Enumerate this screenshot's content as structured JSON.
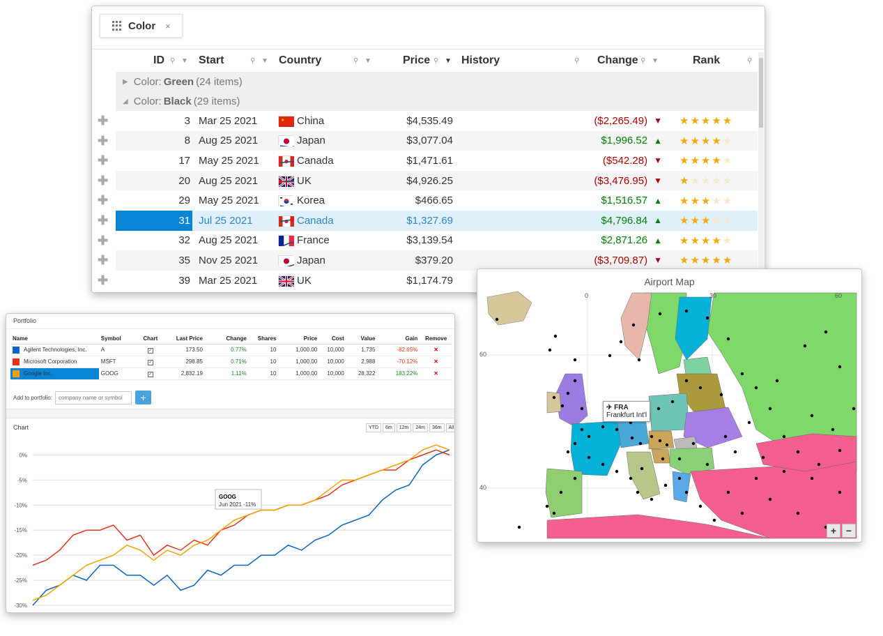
{
  "grid": {
    "group_chip": {
      "label": "Color",
      "close": "×"
    },
    "columns": [
      "ID",
      "Start",
      "Country",
      "Price",
      "History",
      "Change",
      "Rank"
    ],
    "groups": [
      {
        "prefix": "Color:",
        "name": "Green",
        "count": "(24 items)",
        "expanded": false
      },
      {
        "prefix": "Color:",
        "name": "Black",
        "count": "(29 items)",
        "expanded": true
      }
    ],
    "rows": [
      {
        "id": "3",
        "start": "Mar 25 2021",
        "country": "China",
        "flag": "cn",
        "price": "$4,535.49",
        "change": "($2,265.49)",
        "dir": "down",
        "rank": 5
      },
      {
        "id": "8",
        "start": "Aug 25 2021",
        "country": "Japan",
        "flag": "jp",
        "price": "$3,077.04",
        "change": "$1,996.52",
        "dir": "up",
        "rank": 4
      },
      {
        "id": "17",
        "start": "May 25 2021",
        "country": "Canada",
        "flag": "ca",
        "price": "$1,471.61",
        "change": "($542.28)",
        "dir": "down",
        "rank": 4
      },
      {
        "id": "20",
        "start": "Aug 25 2021",
        "country": "UK",
        "flag": "uk",
        "price": "$4,926.25",
        "change": "($3,476.95)",
        "dir": "down",
        "rank": 1
      },
      {
        "id": "29",
        "start": "May 25 2021",
        "country": "Korea",
        "flag": "kr",
        "price": "$466.65",
        "change": "$1,516.57",
        "dir": "up",
        "rank": 3
      },
      {
        "id": "31",
        "start": "Jul 25 2021",
        "country": "Canada",
        "flag": "ca",
        "price": "$1,327.69",
        "change": "$4,796.84",
        "dir": "up",
        "rank": 3,
        "selected": true
      },
      {
        "id": "32",
        "start": "Aug 25 2021",
        "country": "France",
        "flag": "fr",
        "price": "$3,139.54",
        "change": "$2,871.26",
        "dir": "up",
        "rank": 4
      },
      {
        "id": "35",
        "start": "Nov 25 2021",
        "country": "Japan",
        "flag": "jp",
        "price": "$379.20",
        "change": "($3,709.87)",
        "dir": "down",
        "rank": 5
      },
      {
        "id": "39",
        "start": "Mar 25 2021",
        "country": "UK",
        "flag": "uk",
        "price": "$1,174.79",
        "change": "",
        "dir": "",
        "rank": 0
      }
    ],
    "colors": {
      "selected": "#0a84d4",
      "negative": "#b00000",
      "positive": "#008000",
      "star": "#f4a80b",
      "sparkline": "#1f4e8c",
      "spark_marker": "#e8141a"
    }
  },
  "portfolio": {
    "title": "Portfolio",
    "columns": [
      "Name",
      "Symbol",
      "Chart",
      "Last Price",
      "Change",
      "Shares",
      "Price",
      "Cost",
      "Value",
      "Gain",
      "Remove"
    ],
    "rows": [
      {
        "name": "Agilent Technologies, Inc.",
        "color": "#0a64c8",
        "symbol": "A",
        "last": "173.50",
        "change": "0.77%",
        "shares": "10",
        "price": "1,000.00",
        "cost": "10,000",
        "value": "1,735",
        "gain": "-82.65%",
        "gain_dir": "neg"
      },
      {
        "name": "Microsoft Corporation",
        "color": "#e8331c",
        "symbol": "MSFT",
        "last": "298.85",
        "change": "0.71%",
        "shares": "10",
        "price": "1,000.00",
        "cost": "10,000",
        "value": "2,988",
        "gain": "-70.12%",
        "gain_dir": "neg"
      },
      {
        "name": "Google Inc.",
        "color": "#f5a200",
        "symbol": "GOOG",
        "last": "2,832.19",
        "change": "1.11%",
        "shares": "10",
        "price": "1,000.00",
        "cost": "10,000",
        "value": "28,322",
        "gain": "183.22%",
        "gain_dir": "pos",
        "selected": true
      }
    ],
    "add_label": "Add to portfolio:",
    "add_placeholder": "company name or symbol",
    "add_button": "+",
    "remove_glyph": "✕",
    "check_glyph": "✓",
    "chart_title": "Chart",
    "ranges": [
      "YTD",
      "6m",
      "12m",
      "24m",
      "36m",
      "All"
    ],
    "tooltip": {
      "title": "GOOG",
      "text": "Jun 2021 -11%"
    }
  },
  "map": {
    "title": "Airport Map",
    "x_ticks": [
      "0",
      "30",
      "60"
    ],
    "y_ticks": [
      "60",
      "40"
    ],
    "tooltip": {
      "code": "FRA",
      "name": "Frankfurt Int'l"
    },
    "zoom_in": "+",
    "zoom_out": "−"
  },
  "chart_data": {
    "type": "line",
    "title": "",
    "xlabel": "",
    "ylabel": "",
    "ylim": [
      -30,
      2
    ],
    "yticks": [
      "0%",
      "-5%",
      "-10%",
      "-15%",
      "-20%",
      "-25%",
      "-30%"
    ],
    "series": [
      {
        "name": "A",
        "color": "#0a64c8",
        "values": [
          -30,
          -27,
          -26,
          -24,
          -25,
          -22,
          -22,
          -24,
          -24,
          -26,
          -24,
          -27,
          -26,
          -23,
          -24,
          -22,
          -22,
          -20,
          -20,
          -18,
          -19,
          -17,
          -16,
          -14,
          -13,
          -12,
          -9,
          -7,
          -6,
          -2,
          0,
          1
        ]
      },
      {
        "name": "MSFT",
        "color": "#e8331c",
        "values": [
          -22,
          -21,
          -19,
          -16,
          -15,
          -15,
          -14,
          -17,
          -16,
          -20,
          -18,
          -19,
          -17,
          -18,
          -15,
          -14,
          -12,
          -11,
          -11,
          -10,
          -10,
          -9,
          -8,
          -6,
          -5,
          -4,
          -3,
          -3,
          -1,
          0,
          1,
          0
        ]
      },
      {
        "name": "GOOG",
        "color": "#f5a200",
        "values": [
          -29,
          -28,
          -26,
          -24,
          -22,
          -21,
          -20,
          -18,
          -19,
          -21,
          -19,
          -20,
          -18,
          -17,
          -15,
          -13,
          -12,
          -11,
          -11,
          -10,
          -10,
          -9,
          -7,
          -5,
          -5,
          -4,
          -3,
          -2,
          -1,
          1,
          2,
          1
        ]
      }
    ]
  }
}
